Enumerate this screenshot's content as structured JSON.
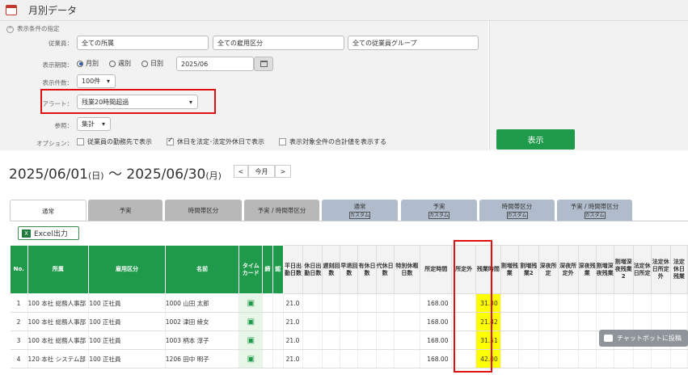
{
  "app": {
    "title": "月別データ"
  },
  "filters": {
    "section_toggle": "表示条件の指定",
    "employee_label": "従業員：",
    "employee_fields": [
      "全ての所属",
      "全ての雇用区分",
      "全ての従業員グループ"
    ],
    "period_label": "表示期間：",
    "period_options": [
      "月別",
      "週別",
      "日別"
    ],
    "period_value": "2025/06",
    "count_label": "表示件数：",
    "count_value": "100件",
    "alert_label": "アラート：",
    "alert_value": "残業20時間超過",
    "ref_label": "参照：",
    "ref_value": "集計",
    "option_label": "オプション：",
    "options": [
      "従業員の勤務先で表示",
      "休日を法定･法定外休日で表示",
      "表示対象全件の合計値を表示する"
    ],
    "show_button": "表示"
  },
  "range": {
    "start": "2025/06/01",
    "start_dow": "(日)",
    "sep": " 〜 ",
    "end": "2025/06/30",
    "end_dow": "(月)"
  },
  "nav": {
    "prev": "<",
    "this_month": "今月",
    "next": ">"
  },
  "tabs": [
    {
      "label": "通常",
      "sub": ""
    },
    {
      "label": "予実",
      "sub": ""
    },
    {
      "label": "時間帯区分",
      "sub": ""
    },
    {
      "label": "予実 / 時間帯区分",
      "sub": ""
    },
    {
      "label": "通常",
      "sub": "カスタム"
    },
    {
      "label": "予実",
      "sub": "カスタム"
    },
    {
      "label": "時間帯区分",
      "sub": "カスタム"
    },
    {
      "label": "予実 / 時間帯区分",
      "sub": "カスタム"
    }
  ],
  "excel_button": "Excel出力",
  "table": {
    "headers": [
      "No.",
      "所属",
      "雇用区分",
      "名前",
      "タイムカード",
      "締",
      "認",
      "平日出勤日数",
      "休日出勤日数",
      "遅刻回数",
      "早退回数",
      "有休日数",
      "代休日数",
      "特別休暇日数",
      "所定時間",
      "所定外",
      "残業時間",
      "割増残業",
      "割増残業2",
      "深夜所定",
      "深夜所定外",
      "深夜残業",
      "割増深夜残業",
      "割増深夜残業2",
      "法定休日所定",
      "法定休日所定外",
      "法定休日残業"
    ],
    "rows": [
      {
        "no": "1",
        "dept": "100 本社 総務人事部",
        "emp_type": "100 正社員",
        "name": "1000 山田 太郎",
        "weekday_days": "21.0",
        "scheduled": "168.00",
        "overtime": "31.30"
      },
      {
        "no": "2",
        "dept": "100 本社 総務人事部",
        "emp_type": "100 正社員",
        "name": "1002 津田 綾女",
        "weekday_days": "21.0",
        "scheduled": "168.00",
        "overtime": "21.42"
      },
      {
        "no": "3",
        "dept": "100 本社 総務人事部",
        "emp_type": "100 正社員",
        "name": "1003 柄本 淳子",
        "weekday_days": "21.0",
        "scheduled": "168.00",
        "overtime": "31.51"
      },
      {
        "no": "4",
        "dept": "120 本社 システム部",
        "emp_type": "100 正社員",
        "name": "1206 田中 明子",
        "weekday_days": "21.0",
        "scheduled": "168.00",
        "overtime": "42.00"
      }
    ]
  },
  "chatbot": "チャットボットに投稿",
  "colors": {
    "accent": "#1f9a4b",
    "highlight": "#ffff00",
    "alert_border": "#e01010"
  }
}
